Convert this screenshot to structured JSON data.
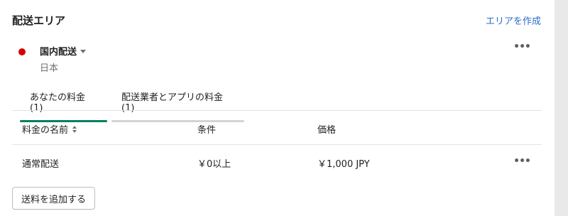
{
  "section": {
    "title": "配送エリア",
    "create_link": "エリアを作成"
  },
  "zone": {
    "name": "国内配送",
    "country": "日本",
    "flag_color": "#d60000",
    "menu_icon": "more-horizontal-icon"
  },
  "tabs": [
    {
      "label": "あなたの料金 (1)",
      "active": true
    },
    {
      "label": "配送業者とアプリの料金 (1)",
      "active": false
    }
  ],
  "table": {
    "headers": {
      "name": "料金の名前",
      "condition": "条件",
      "price": "価格"
    },
    "rows": [
      {
        "name": "通常配送",
        "condition": "￥0以上",
        "price": "￥1,000 JPY"
      }
    ]
  },
  "add_button": "送料を追加する",
  "colors": {
    "accent": "#008060",
    "link": "#2c6ecb"
  }
}
